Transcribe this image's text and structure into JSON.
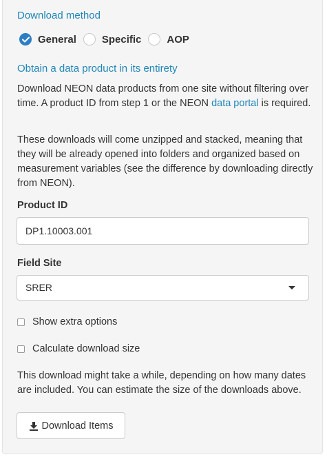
{
  "download_method": {
    "heading": "Download method",
    "options": [
      {
        "label": "General",
        "checked": true
      },
      {
        "label": "Specific",
        "checked": false
      },
      {
        "label": "AOP",
        "checked": false
      }
    ]
  },
  "general": {
    "heading": "Obtain a data product in its entirety",
    "intro_text": "Download NEON data products from one site without filtering over time. A product ID from step 1 or the NEON",
    "intro_link": "data portal",
    "intro_suffix": "is required.",
    "stacked_text": "These downloads will come unzipped and stacked, meaning that they will be already opened into folders and organized based on measurement variables (see the difference by downloading directly from NEON)."
  },
  "product_id": {
    "label": "Product ID",
    "value": "DP1.10003.001"
  },
  "field_site": {
    "label": "Field Site",
    "selected": "SRER"
  },
  "checkboxes": {
    "extra_options": {
      "label": "Show extra options",
      "checked": false
    },
    "download_size": {
      "label": "Calculate download size",
      "checked": false
    }
  },
  "footer_note": "This download might take a while, depending on how many dates are included. You can estimate the size of the downloads above.",
  "download_button": {
    "label": "Download Items",
    "icon": "download-icon"
  },
  "colors": {
    "accent": "#1f86b8",
    "radio_checked": "#2e7ec4",
    "panel_bg": "#f5f5f5",
    "text": "#333333"
  }
}
